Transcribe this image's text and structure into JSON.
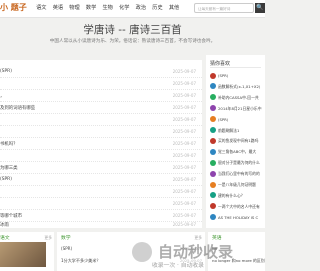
{
  "header": {
    "logo": "小 题子",
    "nav": [
      "语文",
      "英语",
      "物理",
      "数学",
      "生物",
      "化学",
      "政治",
      "历史",
      "其他"
    ],
    "search_placeholder": "让每天都有一篇好诗",
    "search_button": "🔍"
  },
  "hero": {
    "title": "学唐诗 -- 唐诗三百首",
    "subtitle": "中国人常以从小读唐诗为乐、为荣。俗话说：熟读唐诗三百首，不会写诗也会吟。"
  },
  "main_list": [
    {
      "title": "(SPR)",
      "date": "2025-09-07"
    },
    {
      "title": "",
      "date": "2025-09-07"
    },
    {
      "title": "，",
      "date": "2025-09-07"
    },
    {
      "title": "及到的词语有哪些",
      "date": "2025-09-07"
    },
    {
      "title": "",
      "date": "2025-09-07"
    },
    {
      "title": "",
      "date": "2025-09-07"
    },
    {
      "title": "书机吗？",
      "date": "2025-09-07"
    },
    {
      "title": "",
      "date": "2025-09-07"
    },
    {
      "title": "为哪三类",
      "date": "2025-09-07"
    },
    {
      "title": "(SPR)",
      "date": "2025-09-07"
    },
    {
      "title": "",
      "date": "2025-09-07"
    },
    {
      "title": "",
      "date": "2025-09-07"
    },
    {
      "title": "等哪个城市",
      "date": "2025-09-07"
    },
    {
      "title": "冰雨",
      "date": "2025-09-07"
    }
  ],
  "sidebar": {
    "heading": "猜你喜欢",
    "items": [
      {
        "text": "(SPR)",
        "color": "#c0392b"
      },
      {
        "text": "函数解析式(x-1,X1+X2)",
        "color": "#2e86c1"
      },
      {
        "text": "补助内CASSA中-回一共",
        "color": "#27ae60"
      },
      {
        "text": "2014年8月21日星小乐中",
        "color": "#8e44ad"
      },
      {
        "text": "(SPR)",
        "color": "#e67e22"
      },
      {
        "text": "前题刷解法1",
        "color": "#16a085"
      },
      {
        "text": "买的鱼发现中间有1路吗",
        "color": "#c0392b"
      },
      {
        "text": "觉三角各ABC中，最大",
        "color": "#2e86c1"
      },
      {
        "text": "银对分子是最为何的什么",
        "color": "#27ae60"
      },
      {
        "text": "当我们心里中有的写的的",
        "color": "#8e44ad"
      },
      {
        "text": "一是八年级几何证明题",
        "color": "#e67e22"
      },
      {
        "text": "建的有什么心？",
        "color": "#16a085"
      },
      {
        "text": "一两个大中的名人中还有",
        "color": "#c0392b"
      },
      {
        "text": "AS THE HOLIDAY IS C",
        "color": "#2e86c1"
      }
    ]
  },
  "bottom_left": {
    "heading": "语文",
    "more": "更多"
  },
  "bottom_mid": {
    "heading": "数学",
    "more": "更多",
    "rows": [
      {
        "text": "(SPR)",
        "date": "2025-09-07"
      },
      {
        "text": "1分大学不多少美米？",
        "date": "2025-09-07"
      }
    ]
  },
  "bottom_right": {
    "heading": "英语",
    "rows": [
      "lot",
      "no longer 和no more 的区别"
    ]
  },
  "watermark": {
    "text": "自动秒收录",
    "sub": "收录一次 · 自动收录"
  }
}
